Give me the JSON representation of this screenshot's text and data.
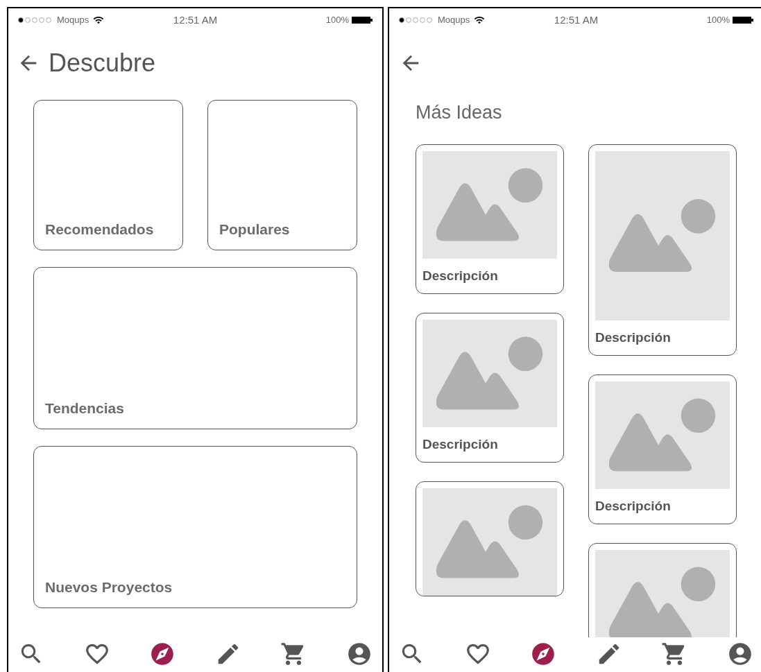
{
  "screens": [
    {
      "status_bar": {
        "carrier": "Moqups",
        "time": "12:51 AM",
        "battery": "100%"
      },
      "title": "Descubre",
      "categories": [
        {
          "label": "Recomendados",
          "kind": "half"
        },
        {
          "label": "Populares",
          "kind": "half"
        },
        {
          "label": "Tendencias",
          "kind": "full"
        },
        {
          "label": "Nuevos Proyectos",
          "kind": "full"
        }
      ],
      "nav": [
        {
          "kind": "search",
          "selected": false
        },
        {
          "kind": "heart",
          "selected": false
        },
        {
          "kind": "compass",
          "selected": true
        },
        {
          "kind": "pencil",
          "selected": false
        },
        {
          "kind": "cart",
          "selected": false
        },
        {
          "kind": "user",
          "selected": false
        }
      ]
    },
    {
      "status_bar": {
        "carrier": "Moqups",
        "time": "12:51 AM",
        "battery": "100%"
      },
      "section_title": "Más Ideas",
      "columns": [
        [
          {
            "description": "Descripción",
            "tall": false
          },
          {
            "description": "Descripción",
            "tall": false
          },
          {
            "tall": false
          }
        ],
        [
          {
            "description": "Descripción",
            "tall": true
          },
          {
            "description": "Descripción",
            "tall": false
          },
          {
            "tall": false
          }
        ]
      ],
      "nav": [
        {
          "kind": "search",
          "selected": false
        },
        {
          "kind": "heart",
          "selected": false
        },
        {
          "kind": "compass",
          "selected": true
        },
        {
          "kind": "pencil",
          "selected": false
        },
        {
          "kind": "cart",
          "selected": false
        },
        {
          "kind": "user",
          "selected": false
        }
      ]
    }
  ]
}
